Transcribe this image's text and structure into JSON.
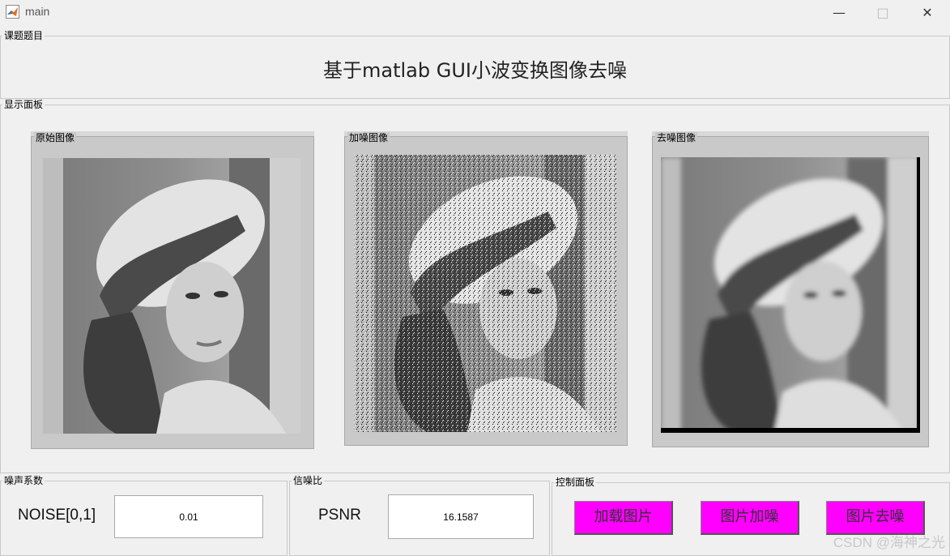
{
  "window": {
    "title": "main",
    "minimize_glyph": "—",
    "maximize_glyph": "□",
    "close_glyph": "✕"
  },
  "topic_panel": {
    "label": "课题题目",
    "heading": "基于matlab GUI小波变换图像去噪"
  },
  "display_panel": {
    "label": "显示面板",
    "images": [
      {
        "label": "原始图像",
        "variant": "original"
      },
      {
        "label": "加噪图像",
        "variant": "noisy"
      },
      {
        "label": "去噪图像",
        "variant": "denoised"
      }
    ]
  },
  "noise_panel": {
    "label": "噪声系数",
    "field_label": "NOISE[0,1]",
    "value": "0.01"
  },
  "psnr_panel": {
    "label": "信噪比",
    "field_label": "PSNR",
    "value": "16.1587"
  },
  "control_panel": {
    "label": "控制面板",
    "buttons": [
      "加载图片",
      "图片加噪",
      "图片去噪"
    ],
    "button_color": "#ff00ff"
  },
  "watermark": "CSDN @海神之光"
}
